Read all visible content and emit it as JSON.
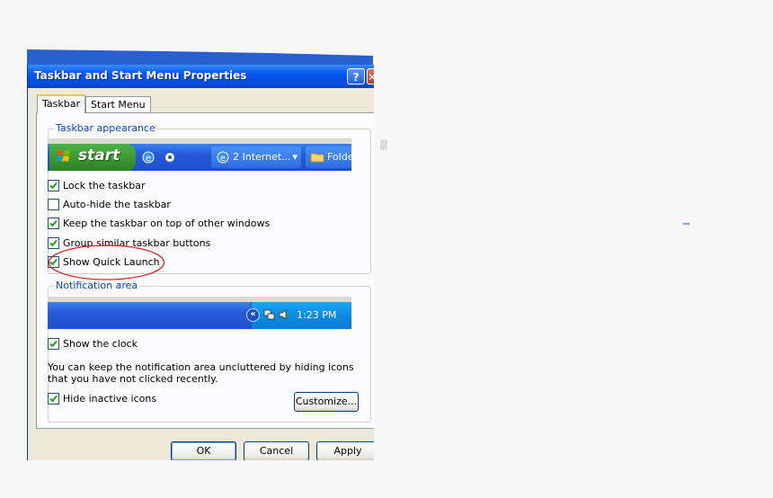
{
  "window": {
    "title": "Taskbar and Start Menu Properties",
    "help_label": "?",
    "close_label": "✕"
  },
  "tabs": [
    {
      "label": "Taskbar",
      "selected": true
    },
    {
      "label": "Start Menu",
      "selected": false
    }
  ],
  "appearance": {
    "legend": "Taskbar appearance",
    "preview": {
      "start_label": "start",
      "task_ie_label": "2 Internet...",
      "task_folder_label": "Folde"
    },
    "options": [
      {
        "label": "Lock the taskbar",
        "checked": true
      },
      {
        "label": "Auto-hide the taskbar",
        "checked": false
      },
      {
        "label": "Keep the taskbar on top of other windows",
        "checked": true
      },
      {
        "label": "Group similar taskbar buttons",
        "checked": true
      },
      {
        "label": "Show Quick Launch",
        "checked": true
      }
    ]
  },
  "notification": {
    "legend": "Notification area",
    "clock_text": "1:23 PM",
    "show_clock": {
      "label": "Show the clock",
      "checked": true
    },
    "description": "You can keep the notification area uncluttered by hiding icons that you have not clicked recently.",
    "hide_inactive": {
      "label": "Hide inactive icons",
      "checked": true
    },
    "customize_label": "Customize..."
  },
  "buttons": {
    "ok": "OK",
    "cancel": "Cancel",
    "apply": "Apply"
  },
  "colors": {
    "annotation_circle": "#d42020",
    "legend_blue": "#0046d5"
  }
}
